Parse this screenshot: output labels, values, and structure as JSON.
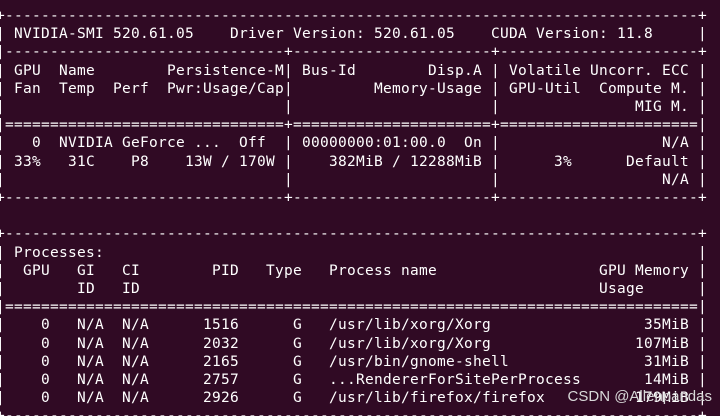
{
  "terminal": {
    "lines": [
      "+-----------------------------------------------------------------------------+",
      "| NVIDIA-SMI 520.61.05    Driver Version: 520.61.05    CUDA Version: 11.8     |",
      "|-------------------------------+----------------------+----------------------+",
      "| GPU  Name        Persistence-M| Bus-Id        Disp.A | Volatile Uncorr. ECC |",
      "| Fan  Temp  Perf  Pwr:Usage/Cap|         Memory-Usage | GPU-Util  Compute M. |",
      "|                               |                      |               MIG M. |",
      "|===============================+======================+======================|",
      "|   0  NVIDIA GeForce ...  Off  | 00000000:01:00.0  On |                  N/A |",
      "| 33%   31C    P8    13W / 170W |    382MiB / 12288MiB |      3%      Default |",
      "|                               |                      |                  N/A |",
      "+-------------------------------+----------------------+----------------------+",
      "",
      "+-----------------------------------------------------------------------------+",
      "| Processes:                                                                  |",
      "|  GPU   GI   CI        PID   Type   Process name                  GPU Memory |",
      "|        ID   ID                                                   Usage      |",
      "|=============================================================================|",
      "|    0   N/A  N/A      1516      G   /usr/lib/xorg/Xorg                 35MiB |",
      "|    0   N/A  N/A      2032      G   /usr/lib/xorg/Xorg                107MiB |",
      "|    0   N/A  N/A      2165      G   /usr/bin/gnome-shell               31MiB |",
      "|    0   N/A  N/A      2757      G   ...RendererForSitePerProcess       14MiB |",
      "|    0   N/A  N/A      2926      G   /usr/lib/firefox/firefox          179MiB |",
      "+-----------------------------------------------------------------------------+"
    ]
  },
  "watermark": "CSDN @Allenpandas",
  "colors": {
    "background": "#300a24",
    "text": "#ffffff"
  }
}
